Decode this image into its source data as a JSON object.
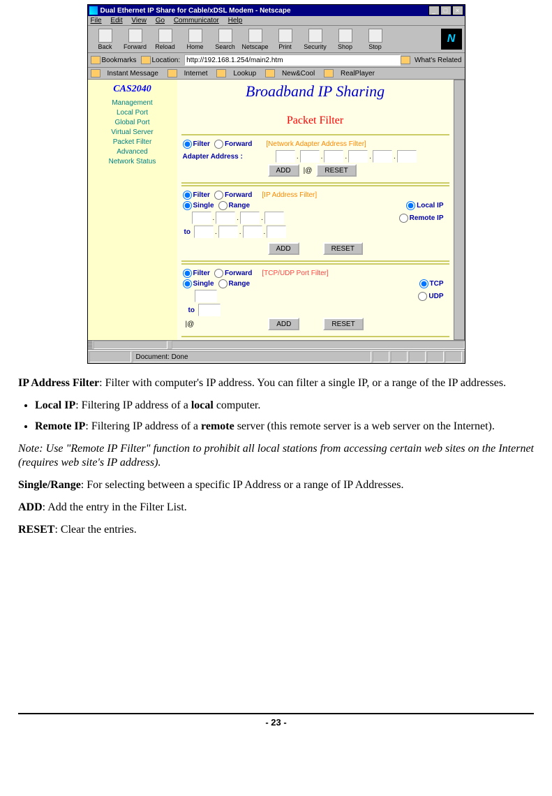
{
  "window": {
    "title": "Dual Ethernet IP Share for Cable/xDSL Modem - Netscape",
    "min": "_",
    "max": "□",
    "close": "×"
  },
  "menubar": [
    "File",
    "Edit",
    "View",
    "Go",
    "Communicator",
    "Help"
  ],
  "toolbar": {
    "items": [
      "Back",
      "Forward",
      "Reload",
      "Home",
      "Search",
      "Netscape",
      "Print",
      "Security",
      "Shop",
      "Stop"
    ]
  },
  "location": {
    "bookmarks": "Bookmarks",
    "label": "Location:",
    "url": "http://192.168.1.254/main2.htm",
    "related": "What's Related"
  },
  "linkbar": [
    "Instant Message",
    "Internet",
    "Lookup",
    "New&Cool",
    "RealPlayer"
  ],
  "sidebar": {
    "brand": "CAS2040",
    "items": [
      "Management",
      "Local Port",
      "Global Port",
      "Virtual Server",
      "Packet Filter",
      "Advanced",
      "Network Status"
    ]
  },
  "banner": "Broadband IP Sharing",
  "page_title": "Packet Filter",
  "sec1": {
    "filter": "Filter",
    "forward": "Forward",
    "label": "[Network Adapter Address Filter]",
    "adapter": "Adapter Address :",
    "add": "ADD",
    "at": "|@",
    "reset": "RESET"
  },
  "sec2": {
    "filter": "Filter",
    "forward": "Forward",
    "label": "[IP Address Filter]",
    "single": "Single",
    "range": "Range",
    "local": "Local IP",
    "remote": "Remote IP",
    "to": "to",
    "add": "ADD",
    "reset": "RESET"
  },
  "sec3": {
    "filter": "Filter",
    "forward": "Forward",
    "label": "[TCP/UDP Port Filter]",
    "single": "Single",
    "range": "Range",
    "tcp": "TCP",
    "udp": "UDP",
    "to": "to",
    "at": "|@",
    "add": "ADD",
    "reset": "RESET"
  },
  "status": {
    "doc": "Document: Done"
  },
  "doc": {
    "ip_filter_bold": "IP Address Filter",
    "ip_filter_rest": ": Filter with computer's IP address. You can filter a single IP, or a range of the IP addresses.",
    "local_bold": "Local IP",
    "local_rest_a": ": Filtering IP address of a ",
    "local_rest_b": "local",
    "local_rest_c": " computer.",
    "remote_bold": "Remote IP",
    "remote_rest_a": ": Filtering IP address of a ",
    "remote_rest_b": "remote",
    "remote_rest_c": " server (this remote server is a web server on the Internet).",
    "note": "Note: Use \"Remote IP Filter\" function to prohibit all local stations from accessing certain web sites on the Internet (requires web site's IP address).",
    "sr_bold": "Single/Range",
    "sr_rest": ": For selecting between a specific IP Address or a range of IP Addresses.",
    "add_bold": "ADD",
    "add_rest": ": Add the entry in the Filter List.",
    "reset_bold": "RESET",
    "reset_rest": ": Clear the entries.",
    "page_num": "- 23 -"
  }
}
